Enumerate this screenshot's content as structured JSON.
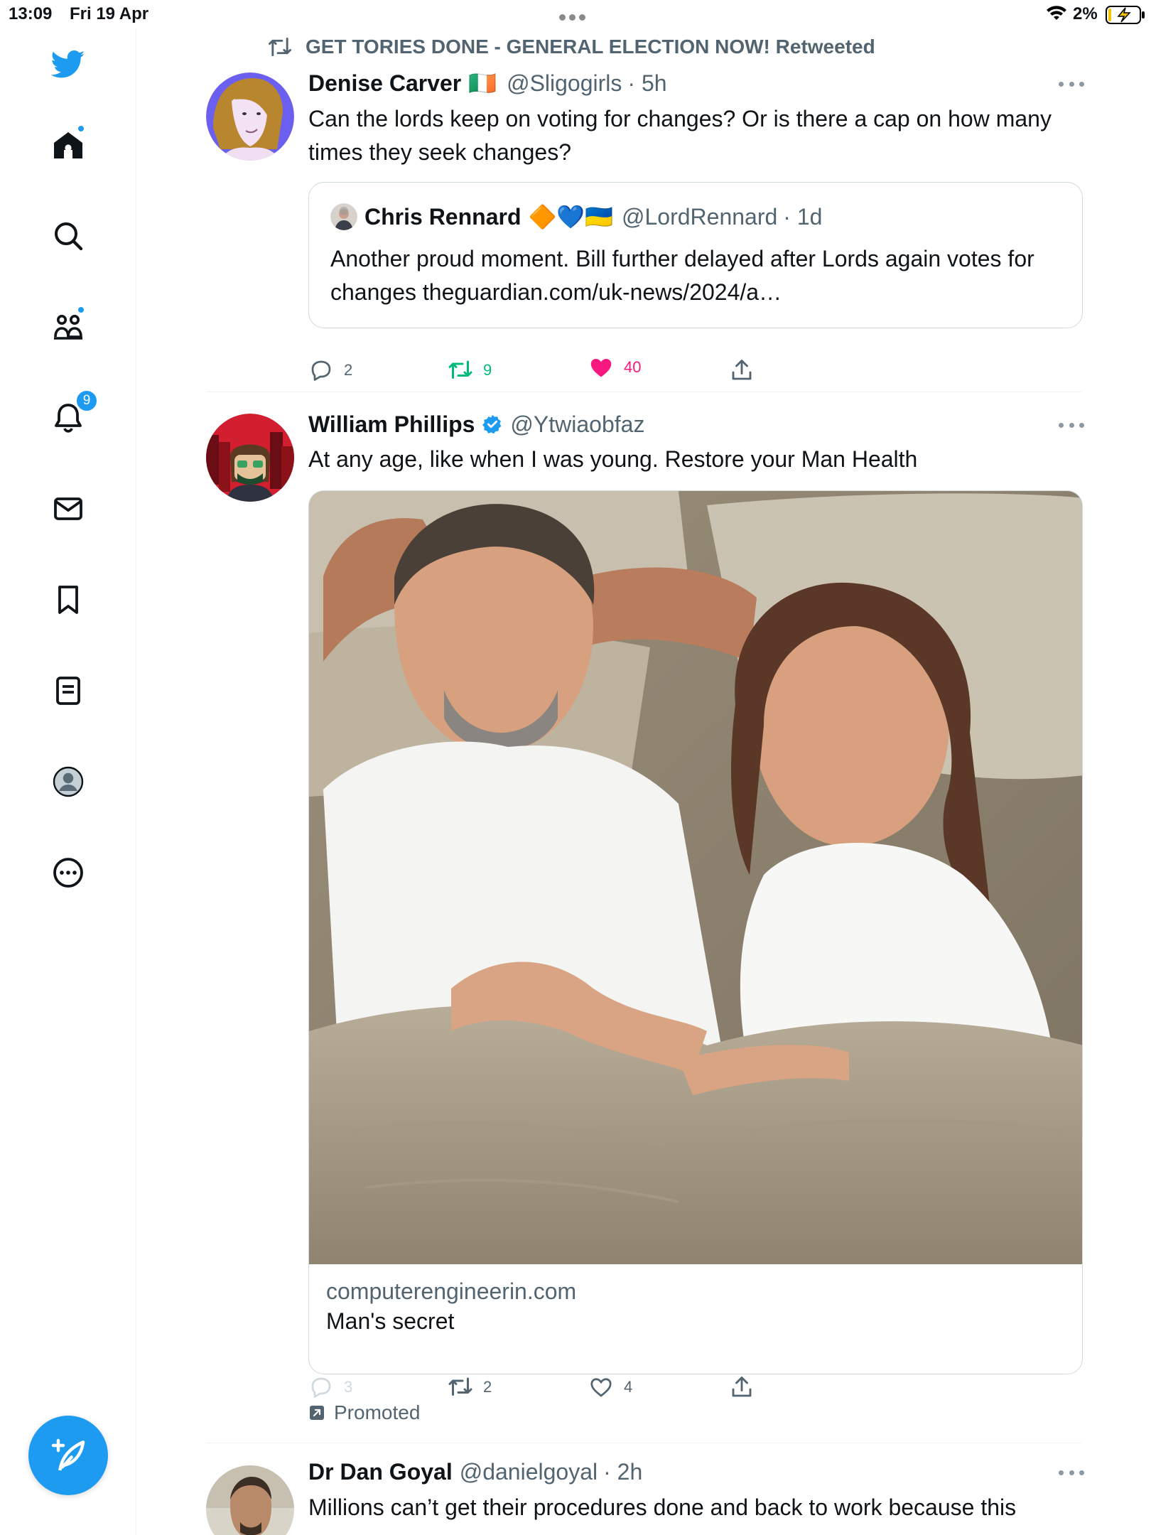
{
  "status_bar": {
    "time": "13:09",
    "date": "Fri 19 Apr",
    "battery": "2%"
  },
  "sidebar": {
    "items": [
      {
        "name": "home",
        "icon": "home-icon",
        "badge": "dot"
      },
      {
        "name": "search",
        "icon": "search-icon"
      },
      {
        "name": "communities",
        "icon": "communities-icon",
        "badge": "dot"
      },
      {
        "name": "notifications",
        "icon": "bell-icon",
        "badge": "9"
      },
      {
        "name": "messages",
        "icon": "mail-icon"
      },
      {
        "name": "bookmarks",
        "icon": "bookmark-icon"
      },
      {
        "name": "lists",
        "icon": "list-icon"
      },
      {
        "name": "profile",
        "icon": "profile-icon"
      },
      {
        "name": "more",
        "icon": "more-circle-icon"
      }
    ],
    "compose_icon": "compose-icon"
  },
  "colors": {
    "accent": "#1d9bf0",
    "like_active": "#f91880",
    "retweet_active": "#00ba7c",
    "secondary_text": "#536471",
    "border": "#cfd9de"
  },
  "tweets": [
    {
      "retweeted_by": "GET TORIES DONE - GENERAL ELECTION NOW! Retweeted",
      "name": "Denise Carver",
      "flag": "🇮🇪",
      "handle": "@Sligogirls",
      "time": "· 5h",
      "text": "Can the lords keep on voting for changes? Or is there a cap on how many times they seek changes?",
      "quote": {
        "name": "Chris Rennard",
        "emojis": "🔶💙🇺🇦",
        "handle": "@LordRennard",
        "time": "· 1d",
        "text": "Another proud moment. Bill further delayed after Lords again votes for changes theguardian.com/uk-news/2024/a…"
      },
      "replies": "2",
      "retweets": "9",
      "likes": "40"
    },
    {
      "name": "William Phillips",
      "handle": "@Ytwiaobfaz",
      "text": "At any age, like when I was young. Restore your Man Health",
      "card_domain": "computerengineerin.com",
      "card_title": "Man's secret",
      "replies": "3",
      "retweets": "2",
      "likes": "4",
      "promoted": "Promoted"
    },
    {
      "name": "Dr Dan Goyal",
      "handle": "@danielgoyal",
      "time": "· 2h",
      "text": "Millions can’t get their procedures done and back to work because this"
    }
  ]
}
